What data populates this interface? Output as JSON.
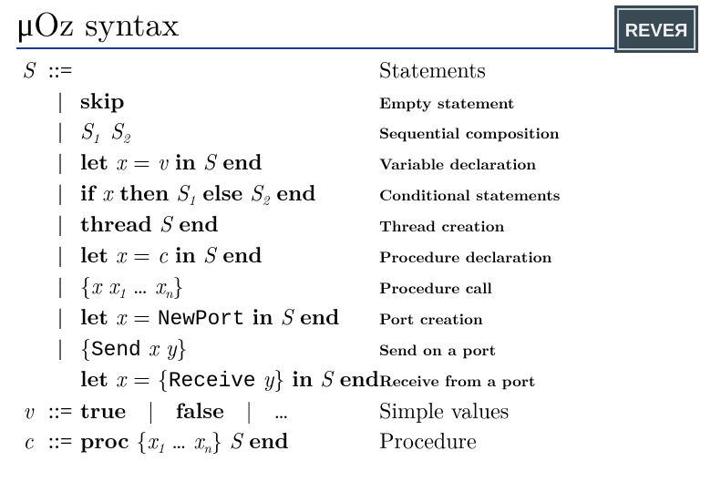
{
  "title": "μOz syntax",
  "logo_text": "REVEЯ",
  "header": {
    "lhs": "S",
    "op": "::=",
    "desc": "Statements"
  },
  "rows": [
    {
      "op": "|",
      "body_html": "<span class='kw'>skip</span>",
      "desc": "Empty statement",
      "desc_small": true
    },
    {
      "op": "|",
      "body_html": "<span class='it'>S</span><span class='sub'>1</span>&nbsp;<span class='it'>S</span><span class='sub'>2</span>",
      "desc": "Sequential composition",
      "desc_small": true
    },
    {
      "op": "|",
      "body_html": "<span class='kw'>let</span> <span class='it'>x</span> = <span class='it'>v</span> <span class='kw'>in</span> <span class='it'>S</span> <span class='kw'>end</span>",
      "desc": "Variable declaration",
      "desc_small": true
    },
    {
      "op": "|",
      "body_html": "<span class='kw'>if</span> <span class='it'>x</span> <span class='kw'>then</span> <span class='it'>S</span><span class='sub'>1</span> <span class='kw'>else</span> <span class='it'>S</span><span class='sub'>2</span> <span class='kw'>end</span>",
      "desc": "Conditional statements",
      "desc_small": true
    },
    {
      "op": "|",
      "body_html": "<span class='kw'>thread</span> <span class='it'>S</span> <span class='kw'>end</span>",
      "desc": "Thread creation",
      "desc_small": true
    },
    {
      "op": "|",
      "body_html": "<span class='kw'>let</span> <span class='it'>x</span> = <span class='it'>c</span> <span class='kw'>in</span> <span class='it'>S</span> <span class='kw'>end</span>",
      "desc": "Procedure declaration",
      "desc_small": true
    },
    {
      "op": "|",
      "body_html": "{<span class='it'>x</span> <span class='it'>x</span><span class='sub'>1</span> … <span class='it'>x</span><span class='sub'>n</span>}",
      "desc": "Procedure call",
      "desc_small": true
    },
    {
      "op": "|",
      "body_html": "<span class='kw'>let</span> <span class='it'>x</span> = <span class='tt'>NewPort</span> <span class='kw'>in</span> <span class='it'>S</span> <span class='kw'>end</span>",
      "desc": "Port creation",
      "desc_small": true
    },
    {
      "op": "|",
      "body_html": "{<span class='tt'>Send</span> <span class='it'>x</span> <span class='it'>y</span>}",
      "desc": "Send on a port",
      "desc_small": true
    },
    {
      "op": "",
      "body_html": "<span class='kw'>let</span> <span class='it'>x</span> = {<span class='tt'>Receive</span> <span class='it'>y</span>} <span class='kw'>in</span> <span class='it'>S</span> <span class='kw'>end</span>",
      "desc": "Receive from a port",
      "desc_small": true
    }
  ],
  "v_row": {
    "lhs": "v",
    "op": "::=",
    "body_html": "<span class='kw'>true</span>&nbsp;&nbsp;|&nbsp;&nbsp;<span class='kw'>false</span>&nbsp;&nbsp;|&nbsp;&nbsp;…",
    "desc": "Simple values"
  },
  "c_row": {
    "lhs": "c",
    "op": "::=",
    "body_html": "<span class='kw'>proc</span> {<span class='it'>x</span><span class='sub'>1</span> … <span class='it'>x</span><span class='sub'>n</span>} <span class='it'>S</span> <span class='kw'>end</span>",
    "desc": "Procedure"
  }
}
